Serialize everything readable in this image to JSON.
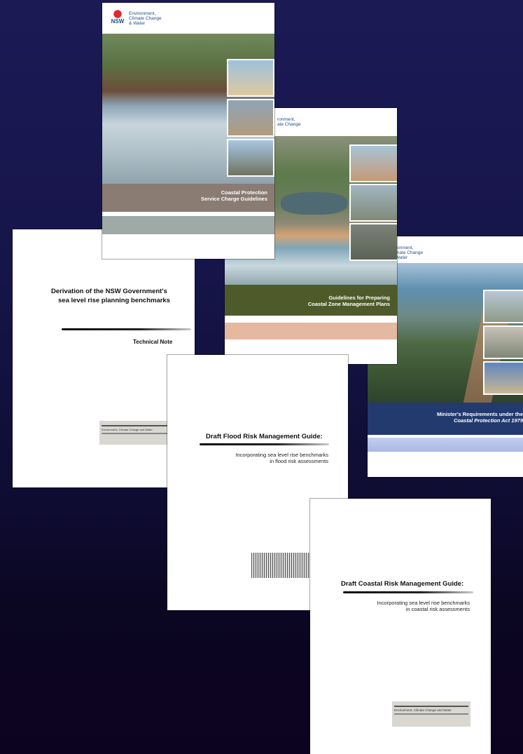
{
  "colors": {
    "background_top": "#1b1a55",
    "background_bottom": "#0c0320",
    "brown_band": "#8a7b73",
    "green_band": "#4f5a2a",
    "navy_band": "#233a6e"
  },
  "documents": {
    "derivation": {
      "title_line1": "Derivation of the NSW Government's",
      "title_line2": "sea level rise planning benchmarks",
      "subtitle": "Technical Note",
      "logo_text": "Environment, Climate Change and Water"
    },
    "flood": {
      "title": "Draft Flood Risk Management Guide:",
      "subtitle_line1": "Incorporating sea level rise benchmarks",
      "subtitle_line2": "in flood risk assessments"
    },
    "coastal_risk": {
      "title": "Draft Coastal Risk Management Guide:",
      "subtitle_line1": "Incorporating sea level rise benchmarks",
      "subtitle_line2": "in coastal risk assessments",
      "logo_text": "Environment, Climate Change and Water"
    },
    "protection": {
      "logo_nsw": "NSW",
      "logo_line1": "Environment,",
      "logo_line2": "Climate Change",
      "logo_line3": "& Water",
      "title_line1": "Coastal Protection",
      "title_line2": "Service Charge Guidelines"
    },
    "czmp": {
      "logo_line1": "ronment,",
      "logo_line2": "ate Change",
      "title_line1": "Guidelines for Preparing",
      "title_line2": "Coastal Zone Management Plans"
    },
    "minister": {
      "logo_line1": "ronment,",
      "logo_line2": "mate Change",
      "logo_line3": "Water",
      "title_line1": "Minister's Requirements under the",
      "title_line2": "Coastal Protection Act 1979"
    }
  }
}
